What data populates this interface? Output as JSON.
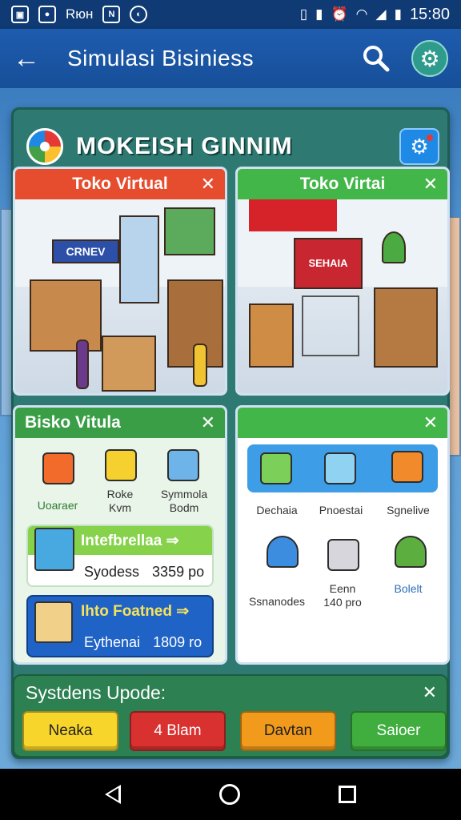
{
  "status_bar": {
    "left_text": "Rюн",
    "time": "15:80",
    "left_icons": [
      "image-icon",
      "chat-icon",
      "notification-icon",
      "shield-icon"
    ],
    "right_icons": [
      "sim-icon",
      "vibrate-icon",
      "alarm-icon",
      "wifi-icon",
      "signal-icon",
      "battery-icon"
    ]
  },
  "app_bar": {
    "title": "Simulasi Bisiniess",
    "icons": [
      "back-arrow-icon",
      "search-icon",
      "gear-icon"
    ]
  },
  "panel": {
    "title": "MOKEISH GINNIM",
    "icons": [
      "pinwheel-logo-icon",
      "settings-gear-icon"
    ]
  },
  "cards": {
    "store_left": {
      "title": "Toko Virtual"
    },
    "store_right": {
      "title": "Toko Virtai",
      "sign_text": "SEHAIA"
    },
    "store_left_sign": "CRNEV",
    "biz": {
      "title": "Bisko Vitula",
      "items": [
        {
          "label": "Uoaraer",
          "icon": "orange-box-icon"
        },
        {
          "label": "Roke\nKvm",
          "icon": "yellow-box-icon"
        },
        {
          "label": "Symmola\nBodm",
          "icon": "blue-box-icon"
        }
      ],
      "promo1": {
        "title": "Intefbrellaa ⇒",
        "label": "Syodess",
        "value": "3359 po"
      },
      "promo2": {
        "title": "Ihto Foatned ⇒",
        "label": "Eythenai",
        "value": "1809 ro"
      }
    },
    "products": {
      "title": "",
      "top_row": [
        {
          "label": "Dechaia",
          "icon": "cart-produce-icon"
        },
        {
          "label": "Pnoestai",
          "icon": "cart-blue-icon"
        },
        {
          "label": "Sgnelive",
          "icon": "gas-pump-icon"
        }
      ],
      "bottom_row": [
        {
          "label": "Ssnanodes",
          "icon": "signpost-icon"
        },
        {
          "label": "Eenn\n140 pro",
          "icon": "fridge-icon"
        },
        {
          "label": "Bolelt",
          "icon": "potted-plant-icon"
        }
      ]
    }
  },
  "system_updates": {
    "title": "Systdens Upode:",
    "buttons": [
      {
        "label": "Neaka",
        "color": "#f7d52b",
        "text_color": "#222"
      },
      {
        "label": "4 Blam",
        "color": "#d93030",
        "text_color": "#ffffff"
      },
      {
        "label": "Davtan",
        "color": "#f29a1b",
        "text_color": "#222"
      },
      {
        "label": "Saioer",
        "color": "#3fae3f",
        "text_color": "#ffffff"
      }
    ]
  },
  "colors": {
    "appbar": "#1e5cae",
    "panel": "#2e7a72",
    "card_red_header": "#e54d2e",
    "card_green_header": "#43b649"
  }
}
